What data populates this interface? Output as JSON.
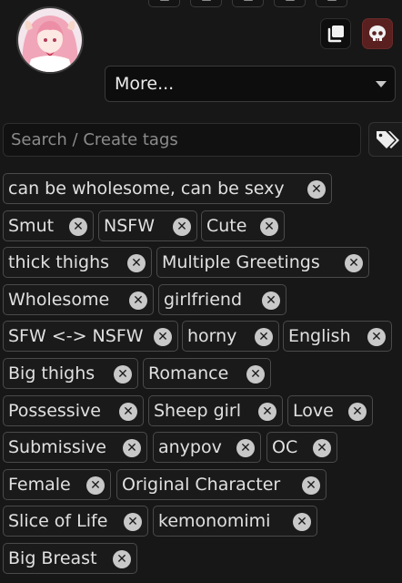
{
  "top_toolbar": {
    "icons": [
      "toolbar-icon",
      "toolbar-icon",
      "toolbar-icon",
      "toolbar-icon",
      "toolbar-icon"
    ]
  },
  "character": {
    "avatar_icon": "character-avatar"
  },
  "actions": {
    "duplicate_icon": "duplicate-icon",
    "delete_icon": "skull-icon",
    "delete_color": "#5a2020"
  },
  "more_select": {
    "selected": "More..."
  },
  "tags_search": {
    "placeholder": "Search / Create tags",
    "tag_icon": "tags-icon"
  },
  "tags": [
    "can be wholesome, can be sexy",
    "Smut",
    "NSFW",
    "Cute",
    "thick thighs",
    "Multiple Greetings",
    "Wholesome",
    "girlfriend",
    "SFW <-> NSFW",
    "horny",
    "English",
    "Big thighs",
    "Romance",
    "Possessive",
    "Sheep girl",
    "Love",
    "Submissive",
    "anypov",
    "OC",
    "Female",
    "Original Character",
    "Slice of Life",
    "kemonomimi",
    "Big Breast"
  ],
  "remove_glyph": "✕"
}
